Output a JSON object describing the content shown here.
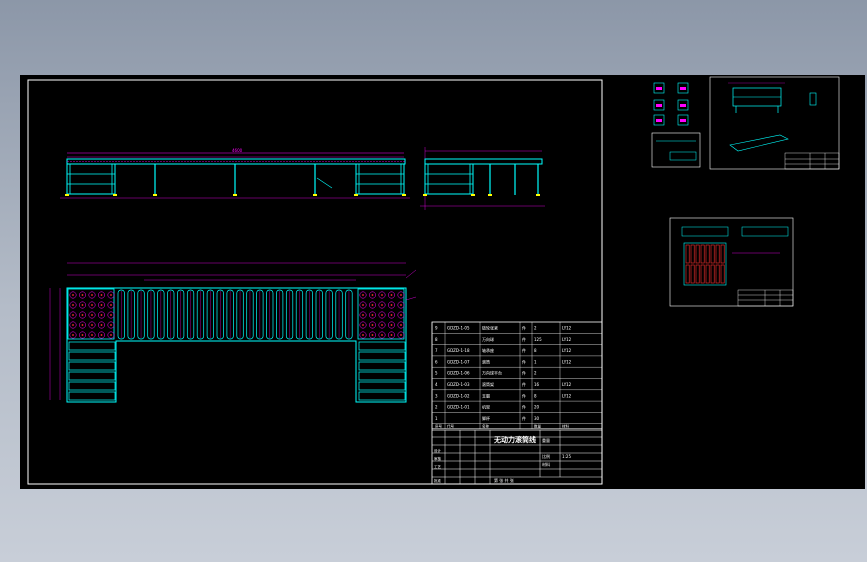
{
  "drawing": {
    "title": "无动力滚筒线",
    "bom_rows": [
      {
        "no": "9",
        "code": "GDZD-1-05",
        "name": "链轮张紧",
        "qty_unit": "件",
        "qty": "2",
        "material": "LY12"
      },
      {
        "no": "8",
        "code": "",
        "name": "万向球",
        "qty_unit": "件",
        "qty": "125",
        "material": "LY12"
      },
      {
        "no": "7",
        "code": "GDZD-1-18",
        "name": "轴承座",
        "qty_unit": "件",
        "qty": "8",
        "material": "LY12"
      },
      {
        "no": "6",
        "code": "GDZD-1-07",
        "name": "滚筒",
        "qty_unit": "件",
        "qty": "1",
        "material": "LY12"
      },
      {
        "no": "5",
        "code": "GDZD-1-06",
        "name": "万向球平台",
        "qty_unit": "件",
        "qty": "2",
        "material": ""
      },
      {
        "no": "4",
        "code": "GDZD-1-03",
        "name": "滚筒架",
        "qty_unit": "件",
        "qty": "16",
        "material": "LY12"
      },
      {
        "no": "3",
        "code": "GDZD-1-02",
        "name": "支腿",
        "qty_unit": "件",
        "qty": "8",
        "material": "LY12"
      },
      {
        "no": "2",
        "code": "GDZD-1-01",
        "name": "机架",
        "qty_unit": "件",
        "qty": "20",
        "material": ""
      },
      {
        "no": "1",
        "code": "",
        "name": "脚杯",
        "qty_unit": "件",
        "qty": "30",
        "material": ""
      }
    ],
    "bom_header": {
      "no": "序号",
      "code": "代号",
      "name": "名称",
      "qty": "数量",
      "material": "材料"
    },
    "title_labels": {
      "weight": "重量",
      "scale": "比例",
      "scale_value": "1:25",
      "material": "材料",
      "sheet": "第 张 共 张"
    },
    "title_rows": [
      "设计",
      "审核",
      "工艺",
      "批准"
    ]
  },
  "colors": {
    "background": "#000000",
    "frame": "#ffffff",
    "structure": "#00ffff",
    "hidden": "#ff00ff",
    "roller": "#ff3030",
    "dimension": "#ff00ff"
  }
}
